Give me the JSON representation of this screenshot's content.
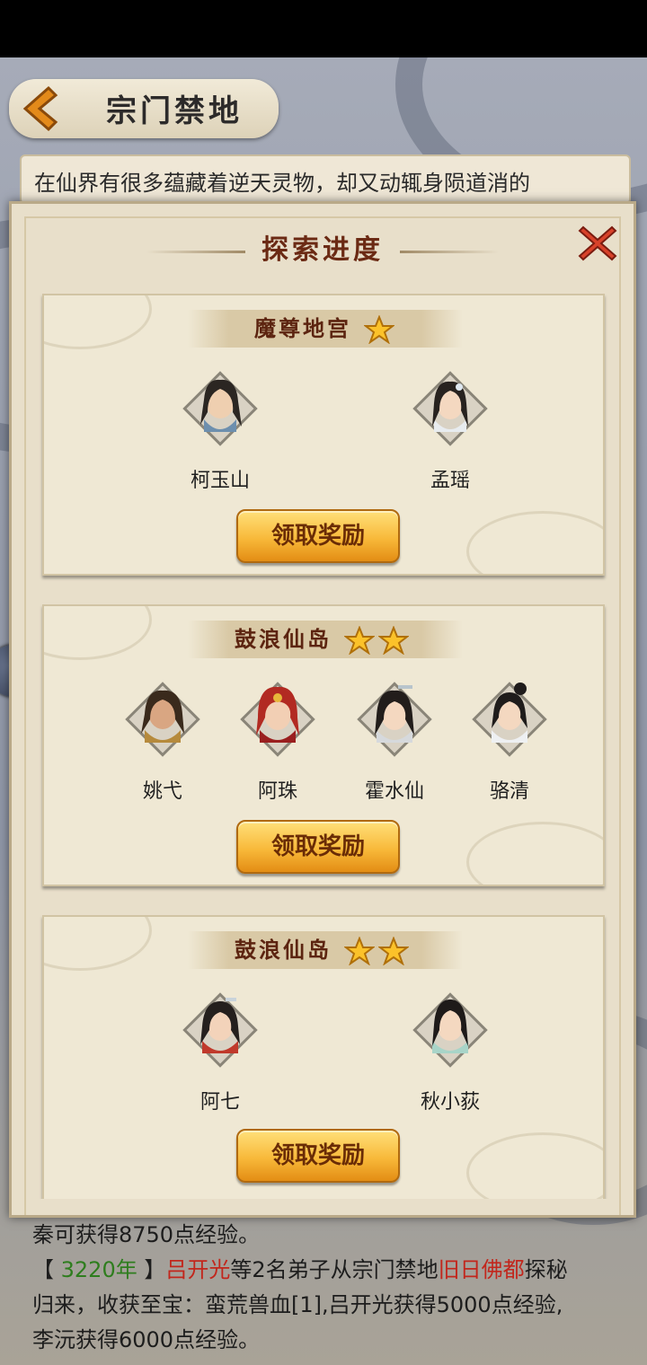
{
  "header": {
    "title": "宗门禁地"
  },
  "intro": {
    "text": "在仙界有很多蕴藏着逆天灵物，却又动辄身陨道消的"
  },
  "modal": {
    "title": "探索进度"
  },
  "sections": [
    {
      "name": "魔尊地宫",
      "stars": 1,
      "characters": [
        {
          "name": "柯玉山"
        },
        {
          "name": "孟瑶"
        }
      ],
      "button": "领取奖励"
    },
    {
      "name": "鼓浪仙岛",
      "stars": 2,
      "characters": [
        {
          "name": "姚弋"
        },
        {
          "name": "阿珠"
        },
        {
          "name": "霍水仙"
        },
        {
          "name": "骆清"
        }
      ],
      "button": "领取奖励"
    },
    {
      "name": "鼓浪仙岛",
      "stars": 2,
      "characters": [
        {
          "name": "阿七"
        },
        {
          "name": "秋小荻"
        }
      ],
      "button": "领取奖励"
    }
  ],
  "log": {
    "line1": "秦可获得8750点经验。",
    "bracket_open": "【 ",
    "year": "3220年",
    "bracket_close": " 】",
    "person": "吕开光",
    "mid": "等2名弟子从宗门禁地",
    "place": "旧日佛都",
    "tail": "探秘",
    "line3": "归来，收获至宝：蛮荒兽血[1],吕开光获得5000点经验,",
    "line4": "李沅获得6000点经验。"
  },
  "colors": {
    "accent_text": "#6b2a14",
    "button_gold": "#f8b93a",
    "year_green": "#2e7d1e",
    "name_red": "#c2261c"
  }
}
